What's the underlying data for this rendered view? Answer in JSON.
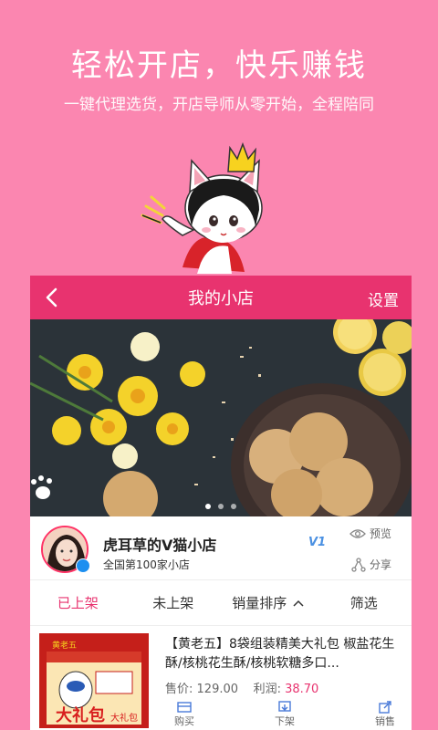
{
  "promo": {
    "headline": "轻松开店，快乐赚钱",
    "subline": "一键代理选货，开店导师从零开始，全程陪同"
  },
  "app": {
    "title": "我的小店",
    "settings_label": "设置"
  },
  "banner": {
    "dots": 3,
    "active_dot": 0
  },
  "shop": {
    "name": "虎耳草的V猫小店",
    "rank": "全国第100家小店",
    "level": "V1",
    "preview_label": "预览",
    "share_label": "分享"
  },
  "tabs": [
    {
      "label": "已上架",
      "active": true
    },
    {
      "label": "未上架",
      "active": false
    },
    {
      "label": "销量排序",
      "active": false
    },
    {
      "label": "筛选",
      "active": false
    }
  ],
  "product": {
    "title": "【黄老五】8袋组装精美大礼包 椒盐花生酥/核桃花生酥/核桃软糖多口...",
    "price_label": "售价:",
    "price": "129.00",
    "profit_label": "利润:",
    "profit": "38.70",
    "image_text_brand": "黄老五",
    "image_text_big": "大礼包",
    "image_text_small": "大礼包",
    "ops": [
      {
        "label": "购买",
        "icon": "card-icon"
      },
      {
        "label": "下架",
        "icon": "unshelve-icon"
      },
      {
        "label": "销售",
        "icon": "share-out-icon"
      }
    ]
  },
  "colors": {
    "background": "#fb86b0",
    "accent": "#e8336f"
  }
}
